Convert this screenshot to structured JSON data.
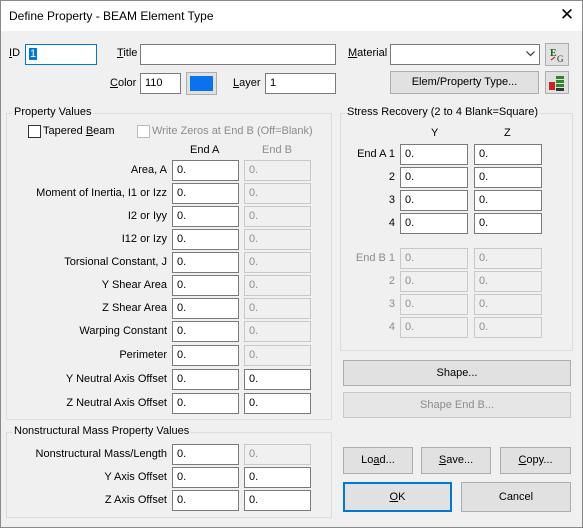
{
  "window": {
    "title": "Define Property - BEAM Element Type",
    "close_glyph": "✕"
  },
  "header": {
    "id_label": "ID",
    "id_value": "1",
    "title_label": "Title",
    "title_value": "",
    "material_label": "Material",
    "material_value": "",
    "color_label": "Color",
    "color_value": "110",
    "color_swatch": "#0a72ef",
    "layer_label": "Layer",
    "layer_value": "1",
    "elem_prop_type_button": "Elem/Property Type...",
    "eq_icon": "equation-icon",
    "prop_icon": "property-grid-icon"
  },
  "property_values": {
    "group_title": "Property Values",
    "tapered_beam_label": "Tapered Beam",
    "write_zeros_label": "Write Zeros at End B (Off=Blank)",
    "col_end_a": "End A",
    "col_end_b": "End B",
    "rows": [
      {
        "label": "Area,  A",
        "end_a": "0.",
        "end_b": "0.",
        "b_enabled": false
      },
      {
        "label": "Moment of Inertia,  I1 or Izz",
        "end_a": "0.",
        "end_b": "0.",
        "b_enabled": false
      },
      {
        "label": "I2 or Iyy",
        "end_a": "0.",
        "end_b": "0.",
        "b_enabled": false
      },
      {
        "label": "I12 or Izy",
        "end_a": "0.",
        "end_b": "0.",
        "b_enabled": false
      },
      {
        "label": "Torsional Constant,  J",
        "end_a": "0.",
        "end_b": "0.",
        "b_enabled": false
      },
      {
        "label": "Y Shear Area",
        "end_a": "0.",
        "end_b": "0.",
        "b_enabled": false
      },
      {
        "label": "Z Shear Area",
        "end_a": "0.",
        "end_b": "0.",
        "b_enabled": false
      },
      {
        "label": "Warping Constant",
        "end_a": "0.",
        "end_b": "0.",
        "b_enabled": false
      },
      {
        "label": "Perimeter",
        "end_a": "0.",
        "end_b": "0.",
        "b_enabled": false
      },
      {
        "label": "Y Neutral Axis Offset",
        "end_a": "0.",
        "end_b": "0.",
        "b_enabled": true
      },
      {
        "label": "Z Neutral Axis Offset",
        "end_a": "0.",
        "end_b": "0.",
        "b_enabled": true
      }
    ]
  },
  "nonstructural": {
    "group_title": "Nonstructural Mass Property Values",
    "rows": [
      {
        "label": "Nonstructural  Mass/Length",
        "end_a": "0.",
        "end_b": "0.",
        "b_enabled": false
      },
      {
        "label": "Y Axis Offset",
        "end_a": "0.",
        "end_b": "0.",
        "b_enabled": true
      },
      {
        "label": "Z Axis Offset",
        "end_a": "0.",
        "end_b": "0.",
        "b_enabled": true
      }
    ]
  },
  "stress_recovery": {
    "group_title": "Stress Recovery (2 to 4 Blank=Square)",
    "col_y": "Y",
    "col_z": "Z",
    "end_a_rows": [
      {
        "label": "End A 1",
        "y": "0.",
        "z": "0."
      },
      {
        "label": "2",
        "y": "0.",
        "z": "0."
      },
      {
        "label": "3",
        "y": "0.",
        "z": "0."
      },
      {
        "label": "4",
        "y": "0.",
        "z": "0."
      }
    ],
    "end_b_rows": [
      {
        "label": "End B 1",
        "y": "0.",
        "z": "0."
      },
      {
        "label": "2",
        "y": "0.",
        "z": "0."
      },
      {
        "label": "3",
        "y": "0.",
        "z": "0."
      },
      {
        "label": "4",
        "y": "0.",
        "z": "0."
      }
    ]
  },
  "buttons": {
    "shape": "Shape...",
    "shape_end_b": "Shape End B...",
    "load": "Load...",
    "save": "Save...",
    "copy": "Copy...",
    "ok": "OK",
    "cancel": "Cancel"
  }
}
